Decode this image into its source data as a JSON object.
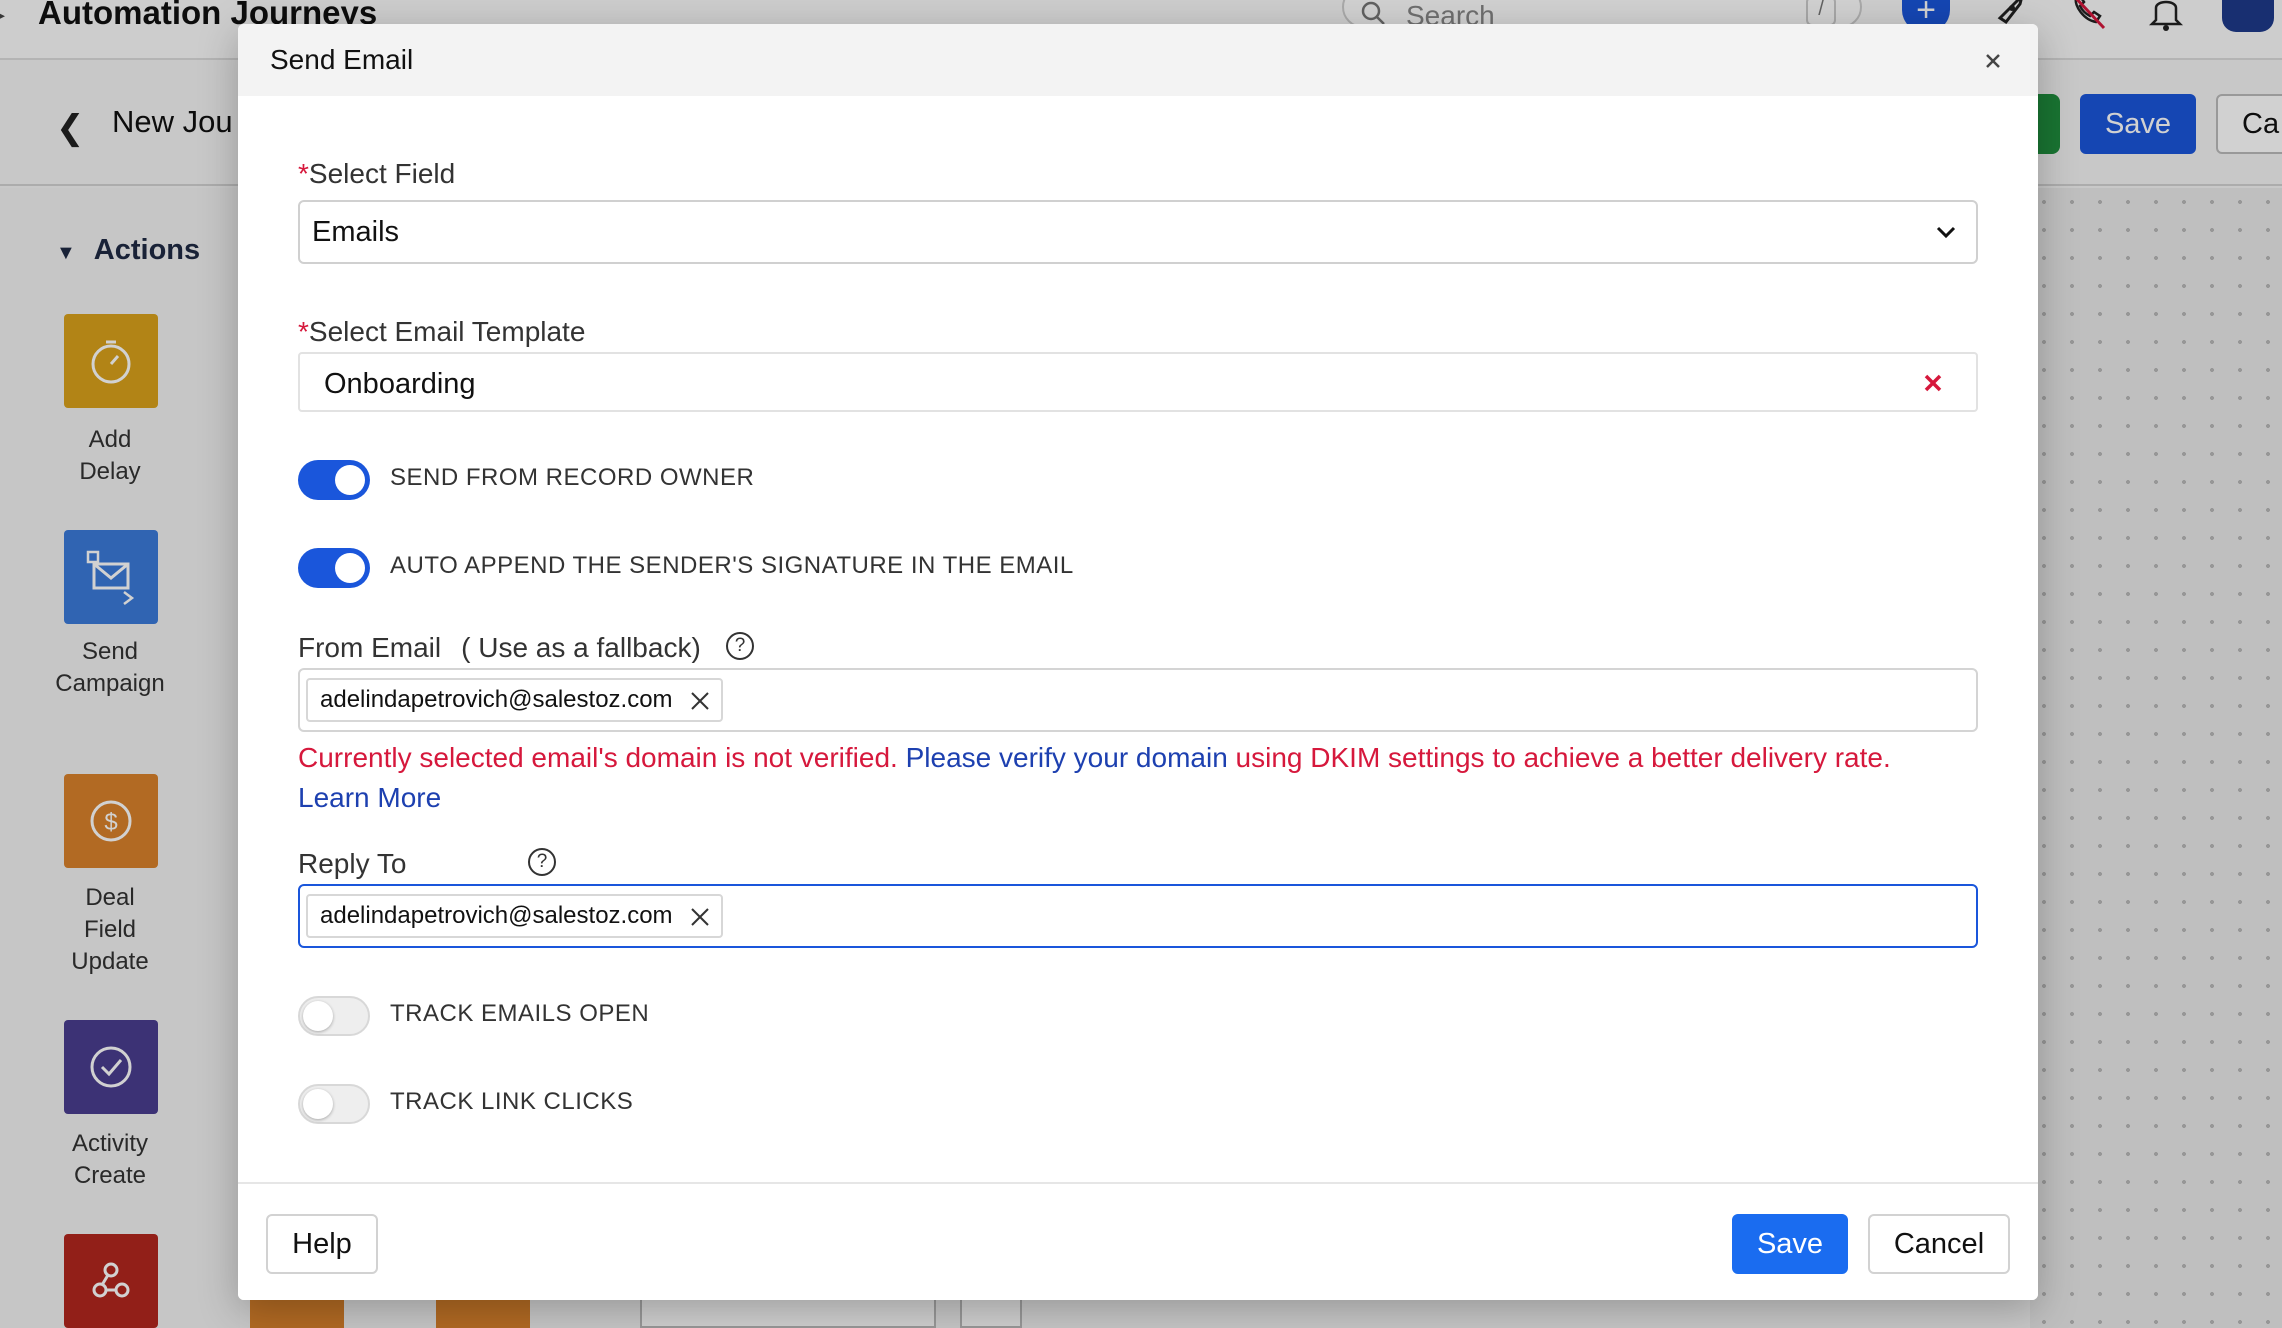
{
  "app": {
    "title": "Automation Journeys",
    "search_placeholder": "Search",
    "search_shortcut": "/",
    "journey_name": "New Jou",
    "save_label": "Save",
    "cancel_label": "Ca",
    "sidebar": {
      "section_title": "Actions",
      "items": [
        {
          "label": "Add\nDelay",
          "icon": "stopwatch-icon",
          "color": "#d9a21c"
        },
        {
          "label": "Send\nCampaign",
          "icon": "campaign-email-icon",
          "color": "#3b7ad9"
        },
        {
          "label": "Deal\nField\nUpdate",
          "icon": "dollar-icon",
          "color": "#d9822b"
        },
        {
          "label": "Activity\nCreate",
          "icon": "check-circle-icon",
          "color": "#4a3d8f"
        },
        {
          "label": "",
          "icon": "webhook-icon",
          "color": "#b3261e"
        }
      ]
    }
  },
  "modal": {
    "title": "Send Email",
    "select_field": {
      "label": "Select Field",
      "required_mark": "*",
      "value": "Emails"
    },
    "email_template": {
      "label": "Select Email Template",
      "required_mark": "*",
      "value": "Onboarding"
    },
    "toggles": [
      {
        "label": "SEND FROM RECORD OWNER",
        "on": true
      },
      {
        "label": "AUTO APPEND THE SENDER'S SIGNATURE IN THE EMAIL",
        "on": true
      },
      {
        "label": "TRACK EMAILS OPEN",
        "on": false
      },
      {
        "label": "TRACK LINK CLICKS",
        "on": false
      }
    ],
    "from_email": {
      "label": "From Email",
      "hint": "( Use as a fallback)",
      "chip": "adelindapetrovich@salestoz.com"
    },
    "warning": {
      "text_before": "Currently selected email's domain is not verified. ",
      "link_verify": "Please verify your domain",
      "text_after": " using DKIM settings to achieve a better delivery rate.",
      "link_learn": "Learn More"
    },
    "reply_to": {
      "label": "Reply To",
      "chip": "adelindapetrovich@salestoz.com"
    },
    "buttons": {
      "help": "Help",
      "save": "Save",
      "cancel": "Cancel"
    },
    "help_glyph": "?"
  },
  "colors": {
    "primary": "#1a56db",
    "danger": "#d6183c",
    "link": "#1d40b0"
  }
}
